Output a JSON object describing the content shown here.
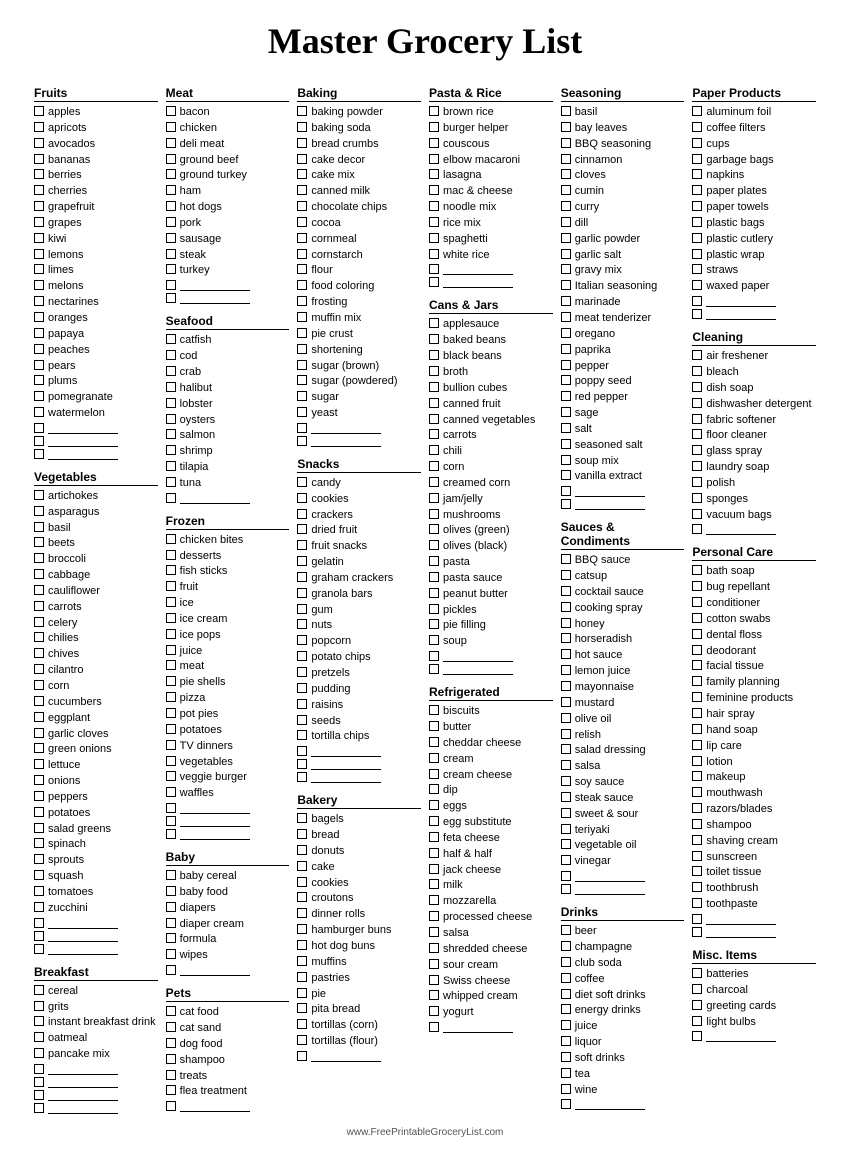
{
  "title": "Master Grocery List",
  "footer": "www.FreePrintableGroceryList.com",
  "columns": [
    {
      "sections": [
        {
          "title": "Fruits",
          "items": [
            "apples",
            "apricots",
            "avocados",
            "bananas",
            "berries",
            "cherries",
            "grapefruit",
            "grapes",
            "kiwi",
            "lemons",
            "limes",
            "melons",
            "nectarines",
            "oranges",
            "papaya",
            "peaches",
            "pears",
            "plums",
            "pomegranate",
            "watermelon",
            "",
            "",
            ""
          ]
        },
        {
          "title": "Vegetables",
          "items": [
            "artichokes",
            "asparagus",
            "basil",
            "beets",
            "broccoli",
            "cabbage",
            "cauliflower",
            "carrots",
            "celery",
            "chilies",
            "chives",
            "cilantro",
            "corn",
            "cucumbers",
            "eggplant",
            "garlic cloves",
            "green onions",
            "lettuce",
            "onions",
            "peppers",
            "potatoes",
            "salad greens",
            "spinach",
            "sprouts",
            "squash",
            "tomatoes",
            "zucchini",
            "",
            "",
            ""
          ]
        },
        {
          "title": "Breakfast",
          "items": [
            "cereal",
            "grits",
            "instant breakfast drink",
            "oatmeal",
            "pancake mix",
            "",
            "",
            "",
            ""
          ]
        }
      ]
    },
    {
      "sections": [
        {
          "title": "Meat",
          "items": [
            "bacon",
            "chicken",
            "deli meat",
            "ground beef",
            "ground turkey",
            "ham",
            "hot dogs",
            "pork",
            "sausage",
            "steak",
            "turkey",
            "",
            ""
          ]
        },
        {
          "title": "Seafood",
          "items": [
            "catfish",
            "cod",
            "crab",
            "halibut",
            "lobster",
            "oysters",
            "salmon",
            "shrimp",
            "tilapia",
            "tuna",
            ""
          ]
        },
        {
          "title": "Frozen",
          "items": [
            "chicken bites",
            "desserts",
            "fish sticks",
            "fruit",
            "ice",
            "ice cream",
            "ice pops",
            "juice",
            "meat",
            "pie shells",
            "pizza",
            "pot pies",
            "potatoes",
            "TV dinners",
            "vegetables",
            "veggie burger",
            "waffles",
            "",
            "",
            ""
          ]
        },
        {
          "title": "Baby",
          "items": [
            "baby cereal",
            "baby food",
            "diapers",
            "diaper cream",
            "formula",
            "wipes",
            ""
          ]
        },
        {
          "title": "Pets",
          "items": [
            "cat food",
            "cat sand",
            "dog food",
            "shampoo",
            "treats",
            "flea treatment",
            ""
          ]
        }
      ]
    },
    {
      "sections": [
        {
          "title": "Baking",
          "items": [
            "baking powder",
            "baking soda",
            "bread crumbs",
            "cake decor",
            "cake mix",
            "canned milk",
            "chocolate chips",
            "cocoa",
            "cornmeal",
            "cornstarch",
            "flour",
            "food coloring",
            "frosting",
            "muffin mix",
            "pie crust",
            "shortening",
            "sugar (brown)",
            "sugar (powdered)",
            "sugar",
            "yeast",
            "",
            ""
          ]
        },
        {
          "title": "Snacks",
          "items": [
            "candy",
            "cookies",
            "crackers",
            "dried fruit",
            "fruit snacks",
            "gelatin",
            "graham crackers",
            "granola bars",
            "gum",
            "nuts",
            "popcorn",
            "potato chips",
            "pretzels",
            "pudding",
            "raisins",
            "seeds",
            "tortilla chips",
            "",
            "",
            ""
          ]
        },
        {
          "title": "Bakery",
          "items": [
            "bagels",
            "bread",
            "donuts",
            "cake",
            "cookies",
            "croutons",
            "dinner rolls",
            "hamburger buns",
            "hot dog buns",
            "muffins",
            "pastries",
            "pie",
            "pita bread",
            "tortillas (corn)",
            "tortillas (flour)",
            ""
          ]
        }
      ]
    },
    {
      "sections": [
        {
          "title": "Pasta & Rice",
          "items": [
            "brown rice",
            "burger helper",
            "couscous",
            "elbow macaroni",
            "lasagna",
            "mac & cheese",
            "noodle mix",
            "rice mix",
            "spaghetti",
            "white rice",
            "",
            ""
          ]
        },
        {
          "title": "Cans & Jars",
          "items": [
            "applesauce",
            "baked beans",
            "black beans",
            "broth",
            "bullion cubes",
            "canned fruit",
            "canned vegetables",
            "carrots",
            "chili",
            "corn",
            "creamed corn",
            "jam/jelly",
            "mushrooms",
            "olives (green)",
            "olives (black)",
            "pasta",
            "pasta sauce",
            "peanut butter",
            "pickles",
            "pie filling",
            "soup",
            "",
            ""
          ]
        },
        {
          "title": "Refrigerated",
          "items": [
            "biscuits",
            "butter",
            "cheddar cheese",
            "cream",
            "cream cheese",
            "dip",
            "eggs",
            "egg substitute",
            "feta cheese",
            "half & half",
            "jack cheese",
            "milk",
            "mozzarella",
            "processed cheese",
            "salsa",
            "shredded cheese",
            "sour cream",
            "Swiss cheese",
            "whipped cream",
            "yogurt",
            ""
          ]
        }
      ]
    },
    {
      "sections": [
        {
          "title": "Seasoning",
          "items": [
            "basil",
            "bay leaves",
            "BBQ seasoning",
            "cinnamon",
            "cloves",
            "cumin",
            "curry",
            "dill",
            "garlic powder",
            "garlic salt",
            "gravy mix",
            "Italian seasoning",
            "marinade",
            "meat tenderizer",
            "oregano",
            "paprika",
            "pepper",
            "poppy seed",
            "red pepper",
            "sage",
            "salt",
            "seasoned salt",
            "soup mix",
            "vanilla extract",
            "",
            ""
          ]
        },
        {
          "title": "Sauces & Condiments",
          "items": [
            "BBQ sauce",
            "catsup",
            "cocktail sauce",
            "cooking spray",
            "honey",
            "horseradish",
            "hot sauce",
            "lemon juice",
            "mayonnaise",
            "mustard",
            "olive oil",
            "relish",
            "salad dressing",
            "salsa",
            "soy sauce",
            "steak sauce",
            "sweet & sour",
            "teriyaki",
            "vegetable oil",
            "vinegar",
            "",
            ""
          ]
        },
        {
          "title": "Drinks",
          "items": [
            "beer",
            "champagne",
            "club soda",
            "coffee",
            "diet soft drinks",
            "energy drinks",
            "juice",
            "liquor",
            "soft drinks",
            "tea",
            "wine",
            ""
          ]
        }
      ]
    },
    {
      "sections": [
        {
          "title": "Paper Products",
          "items": [
            "aluminum foil",
            "coffee filters",
            "cups",
            "garbage bags",
            "napkins",
            "paper plates",
            "paper towels",
            "plastic bags",
            "plastic cutlery",
            "plastic wrap",
            "straws",
            "waxed paper",
            "",
            ""
          ]
        },
        {
          "title": "Cleaning",
          "items": [
            "air freshener",
            "bleach",
            "dish soap",
            "dishwasher detergent",
            "fabric softener",
            "floor cleaner",
            "glass spray",
            "laundry soap",
            "polish",
            "sponges",
            "vacuum bags",
            ""
          ]
        },
        {
          "title": "Personal Care",
          "items": [
            "bath soap",
            "bug repellant",
            "conditioner",
            "cotton swabs",
            "dental floss",
            "deodorant",
            "facial tissue",
            "family planning",
            "feminine products",
            "hair spray",
            "hand soap",
            "lip care",
            "lotion",
            "makeup",
            "mouthwash",
            "razors/blades",
            "shampoo",
            "shaving cream",
            "sunscreen",
            "toilet tissue",
            "toothbrush",
            "toothpaste",
            "",
            ""
          ]
        },
        {
          "title": "Misc. Items",
          "items": [
            "batteries",
            "charcoal",
            "greeting cards",
            "light bulbs",
            ""
          ]
        }
      ]
    }
  ]
}
